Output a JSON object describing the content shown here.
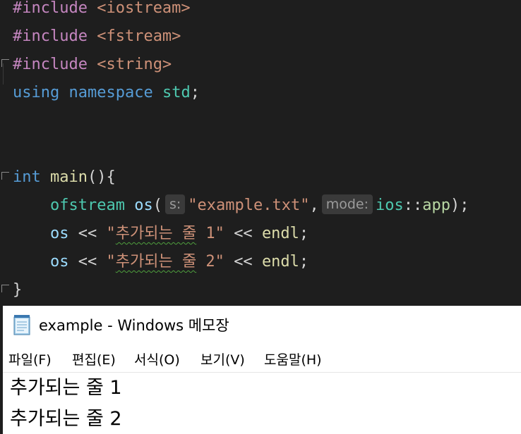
{
  "editor": {
    "lines": [
      {
        "pre": "#include",
        "str": "<iostream>"
      },
      {
        "pre": "#include",
        "str": "<fstream>"
      },
      {
        "pre": "#include",
        "str": "<string>"
      }
    ],
    "using": {
      "kw1": "using",
      "kw2": "namespace",
      "ns": "std",
      "semi": ";"
    },
    "main": {
      "type": "int",
      "name": "main",
      "paren": "(){"
    },
    "line_ofstream": {
      "type": "ofstream",
      "var": "os",
      "open": "(",
      "hint1": "s:",
      "arg1": "\"example.txt\"",
      "comma": ",",
      "hint2": "mode:",
      "ns": "ios",
      "sep": "::",
      "member": "app",
      "close": ");"
    },
    "line_out1": {
      "var": "os",
      "op": "<<",
      "str_q": "\"",
      "str_text": "추가되는 줄",
      "str_rest": " 1\"",
      "op2": "<<",
      "endl": "endl",
      "semi": ";"
    },
    "line_out2": {
      "var": "os",
      "op": "<<",
      "str_q": "\"",
      "str_text": "추가되는 줄",
      "str_rest": " 2\"",
      "op2": "<<",
      "endl": "endl",
      "semi": ";"
    },
    "close_brace": "}"
  },
  "notepad": {
    "title": "example - Windows 메모장",
    "icon": "notepad-icon",
    "menu": [
      "파일(F)",
      "편집(E)",
      "서식(O)",
      "보기(V)",
      "도움말(H)"
    ],
    "content": [
      "추가되는 줄 1",
      "추가되는 줄 2"
    ]
  }
}
